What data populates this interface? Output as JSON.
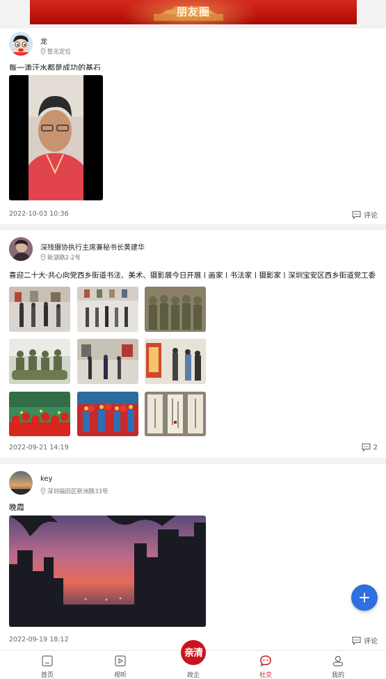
{
  "banner": {
    "title": "朋友圈"
  },
  "posts": [
    {
      "user": "龙",
      "location": "暂无定位",
      "text": "每一滴汗水都是成功的基石",
      "time": "2022-10-03 10:36",
      "comment_label": "评论"
    },
    {
      "user": "深残摄协执行主席兼秘书长黄建华",
      "location": "新湖路2-2号",
      "text": "喜迎二十大·共心向党西乡街道书法、美术、摄影展今日开展 | 画家 | 书法家 | 摄影家 | 深圳宝安区西乡街道党工委 · 办事处 · 西乡",
      "time": "2022-09-21 14:19",
      "comment_count": "2"
    },
    {
      "user": "key",
      "location": "深圳福田区新洲路33号",
      "text": "晚霞",
      "time": "2022-09-19 18:12",
      "comment_label": "评论"
    }
  ],
  "tabs": [
    {
      "label": "首页",
      "icon": "home-icon"
    },
    {
      "label": "视听",
      "icon": "video-icon"
    },
    {
      "label": "政企",
      "icon": "center-logo"
    },
    {
      "label": "社交",
      "icon": "chat-icon"
    },
    {
      "label": "我的",
      "icon": "user-icon"
    }
  ],
  "center_badge": "亲清",
  "colors": {
    "accent": "#c8151d",
    "fab": "#2f6fde"
  }
}
